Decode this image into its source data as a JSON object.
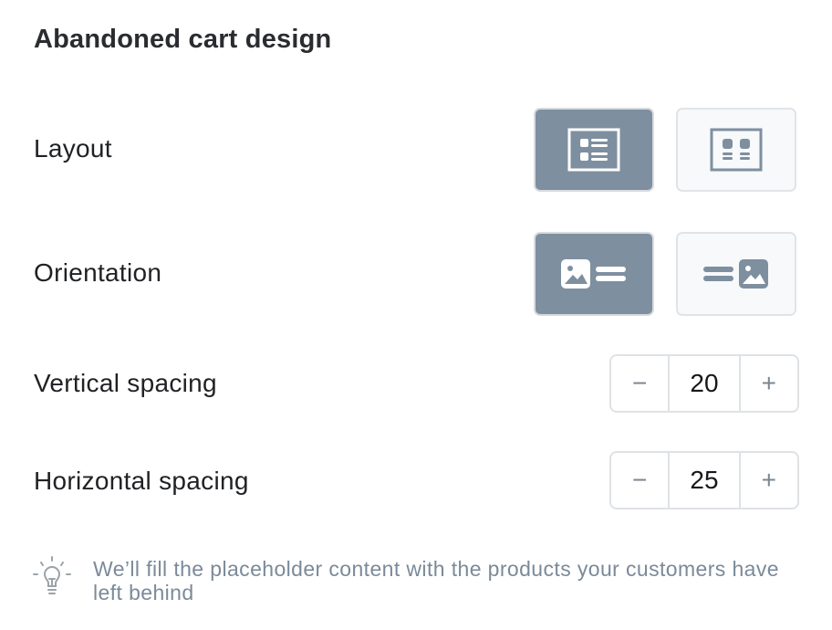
{
  "title": "Abandoned cart design",
  "layout": {
    "label": "Layout",
    "options": [
      {
        "name": "list-layout",
        "icon": "list-layout-icon",
        "selected": true
      },
      {
        "name": "grid-layout",
        "icon": "grid-layout-icon",
        "selected": false
      }
    ]
  },
  "orientation": {
    "label": "Orientation",
    "options": [
      {
        "name": "image-left",
        "icon": "image-left-icon",
        "selected": true
      },
      {
        "name": "image-right",
        "icon": "image-right-icon",
        "selected": false
      }
    ]
  },
  "vertical_spacing": {
    "label": "Vertical spacing",
    "value": "20",
    "decrement": "−",
    "increment": "+"
  },
  "horizontal_spacing": {
    "label": "Horizontal spacing",
    "value": "25",
    "decrement": "−",
    "increment": "+"
  },
  "hint": {
    "icon": "lightbulb-icon",
    "text": "We’ll fill the placeholder content with the products your customers have left behind"
  },
  "colors": {
    "accent": "#7e8fa0",
    "inactive_bg": "#f7f9fa",
    "hint_text": "#7b8a99"
  }
}
